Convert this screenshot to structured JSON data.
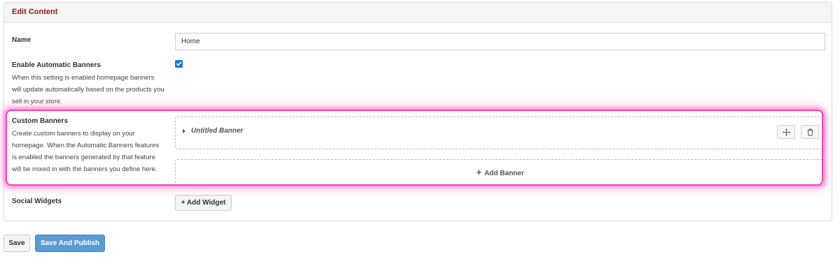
{
  "panel": {
    "title": "Edit Content"
  },
  "name_field": {
    "label": "Name",
    "value": "Home"
  },
  "automatic_banners": {
    "label": "Enable Automatic Banners",
    "help_lines": [
      "When this setting is enabled homepage banners",
      "will update automatically based on the products you",
      "sell in your store."
    ],
    "checked": true
  },
  "custom_banners": {
    "label": "Custom Banners",
    "help_lines": [
      "Create custom banners to display on your",
      "homepage. When the Automatic Banners features",
      "is enabled the banners generated by that feature",
      "will be mixed in with the banners you define here."
    ],
    "banners": [
      {
        "title": "Untitled Banner"
      }
    ],
    "add_banner_label": "Add Banner",
    "move_icon": "move-icon",
    "delete_icon": "trash-icon"
  },
  "social_widgets": {
    "label": "Social Widgets",
    "add_widget_label": "+ Add Widget"
  },
  "footer": {
    "save_label": "Save",
    "save_publish_label": "Save And Publish"
  },
  "colors": {
    "header_title": "#8b1a1a",
    "highlight": "#ff3fb4",
    "primary_button": "#5b9bd5",
    "checkbox": "#1a73e8"
  }
}
